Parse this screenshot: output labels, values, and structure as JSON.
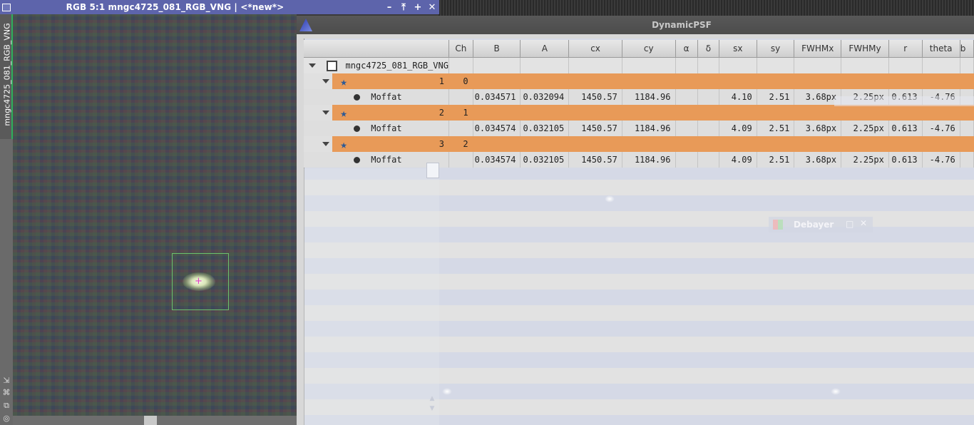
{
  "image_window": {
    "title": "RGB 5:1 mngc4725_081_RGB_VNG | <*new*>",
    "controls": [
      "minimize",
      "shade",
      "maximize",
      "close"
    ],
    "control_glyphs": [
      "–",
      "⤒",
      "+",
      "✕"
    ],
    "side_tab_label": "mngc4725_081_RGB_VNG",
    "side_tools": [
      "⇲",
      "⌘",
      "⧉",
      "◎"
    ]
  },
  "psf_window": {
    "title": "DynamicPSF",
    "columns": [
      "",
      "Ch",
      "B",
      "A",
      "cx",
      "cy",
      "α",
      "δ",
      "sx",
      "sy",
      "FWHMx",
      "FWHMy",
      "r",
      "theta",
      "b"
    ],
    "root_label": "mngc4725_081_RGB_VNG",
    "stars": [
      {
        "index": "1",
        "ch": "0",
        "fit": {
          "function": "Moffat",
          "B": "0.034571",
          "A": "0.032094",
          "cx": "1450.57",
          "cy": "1184.96",
          "alpha": "",
          "delta": "",
          "sx": "4.10",
          "sy": "2.51",
          "FWHMx": "3.68px",
          "FWHMy": "2.25px",
          "r": "0.613",
          "theta": "-4.76"
        }
      },
      {
        "index": "2",
        "ch": "1",
        "fit": {
          "function": "Moffat",
          "B": "0.034574",
          "A": "0.032105",
          "cx": "1450.57",
          "cy": "1184.96",
          "alpha": "",
          "delta": "",
          "sx": "4.09",
          "sy": "2.51",
          "FWHMx": "3.68px",
          "FWHMy": "2.25px",
          "r": "0.613",
          "theta": "-4.76"
        }
      },
      {
        "index": "3",
        "ch": "2",
        "fit": {
          "function": "Moffat",
          "B": "0.034574",
          "A": "0.032105",
          "cx": "1450.57",
          "cy": "1184.96",
          "alpha": "",
          "delta": "",
          "sx": "4.09",
          "sy": "2.51",
          "FWHMx": "3.68px",
          "FWHMy": "2.25px",
          "r": "0.613",
          "theta": "-4.76"
        }
      }
    ]
  },
  "ghost_window": {
    "title": "Debayer",
    "controls": [
      "□",
      "✕"
    ]
  },
  "colors": {
    "image_titlebar": "#5d64ab",
    "star_row": "#e89a58",
    "star_icon": "#2d5a96",
    "psf_box": "#6cc06c",
    "centroid_cross": "#e040c8",
    "side_tab_accent": "#2fae5c"
  }
}
